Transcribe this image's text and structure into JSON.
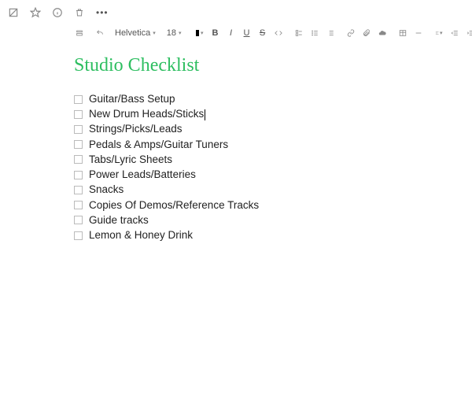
{
  "topbar": {
    "more_label": "•••"
  },
  "toolbar": {
    "font_family": "Helvetica",
    "font_size": "18",
    "bold": "B",
    "italic": "I",
    "underline": "U",
    "strike": "S"
  },
  "note": {
    "title": "Studio Checklist",
    "items": [
      "Guitar/Bass Setup",
      "New Drum Heads/Sticks",
      "Strings/Picks/Leads",
      "Pedals & Amps/Guitar Tuners",
      "Tabs/Lyric Sheets",
      "Power Leads/Batteries",
      "Snacks",
      "Copies Of Demos/Reference Tracks",
      "Guide tracks",
      "Lemon & Honey Drink"
    ],
    "cursor_index": 1
  }
}
